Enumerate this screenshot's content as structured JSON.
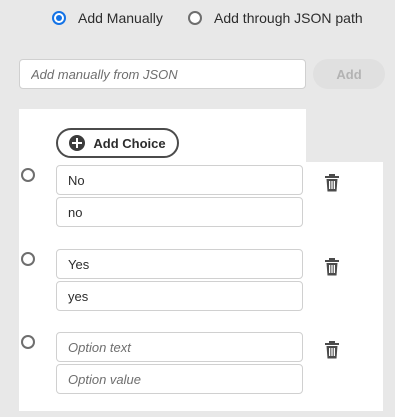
{
  "source_mode": {
    "options": [
      {
        "label": "Add Manually",
        "selected": true
      },
      {
        "label": "Add through JSON path",
        "selected": false
      }
    ]
  },
  "json_input": {
    "placeholder": "Add manually from JSON",
    "value": ""
  },
  "add_button": {
    "label": "Add",
    "disabled": true
  },
  "add_choice_button": {
    "label": "Add Choice",
    "icon": "plus-circle-icon"
  },
  "choices": [
    {
      "text": "No",
      "value": "no",
      "text_placeholder": "Option text",
      "value_placeholder": "Option value",
      "selected": false
    },
    {
      "text": "Yes",
      "value": "yes",
      "text_placeholder": "Option text",
      "value_placeholder": "Option value",
      "selected": false
    },
    {
      "text": "",
      "value": "",
      "text_placeholder": "Option text",
      "value_placeholder": "Option value",
      "selected": false
    }
  ],
  "colors": {
    "accent": "#1473e6",
    "background": "#e8e8e8",
    "panel": "#ffffff",
    "disabled_text": "#b3b3b3"
  }
}
